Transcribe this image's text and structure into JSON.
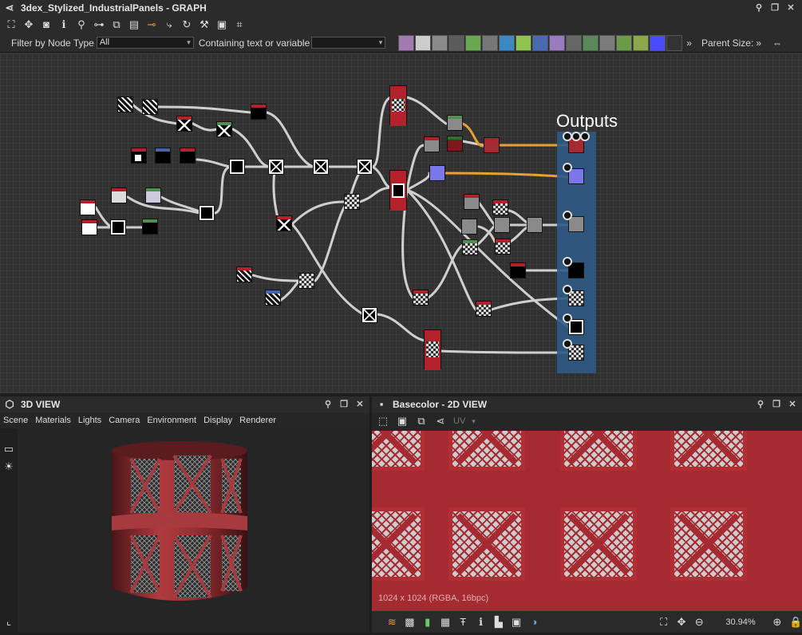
{
  "graph": {
    "title": "3dex_Stylized_IndustrialPanels - GRAPH",
    "filter_label": "Filter by Node Type",
    "filter_value": "All",
    "containing_label": "Containing text or variable",
    "containing_value": "",
    "parent_size_label": "Parent Size:",
    "outputs_label": "Outputs"
  },
  "view3d": {
    "title": "3D VIEW",
    "menu": [
      "Scene",
      "Materials",
      "Lights",
      "Camera",
      "Environment",
      "Display",
      "Renderer"
    ]
  },
  "view2d": {
    "title": "Basecolor - 2D VIEW",
    "uv_label": "UV",
    "resolution_info": "1024 x 1024 (RGBA, 16bpc)",
    "zoom": "30.94%"
  },
  "colors": {
    "accent_orange": "#e8a030",
    "output_strip": "#2f5b86",
    "material_red": "#a62a31"
  }
}
